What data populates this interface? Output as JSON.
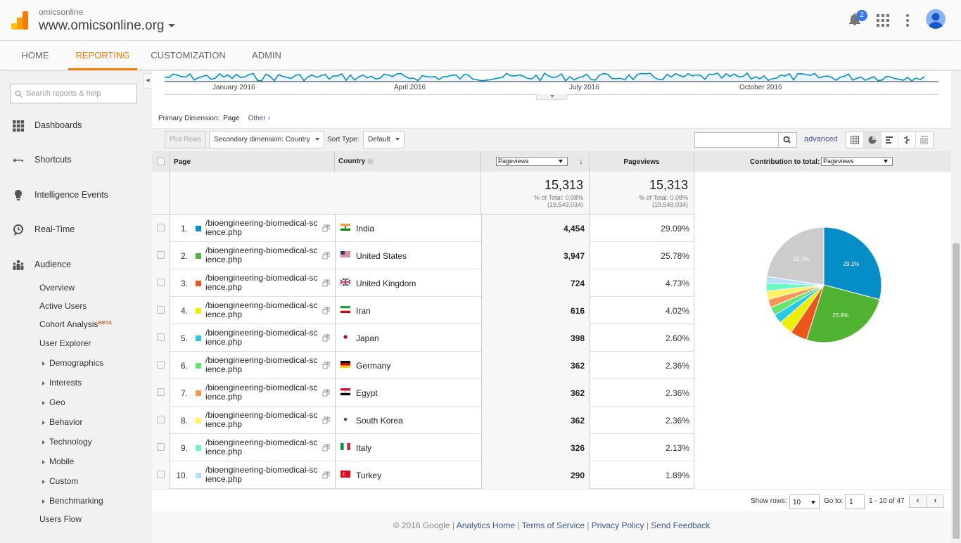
{
  "header": {
    "account": "omicsonline",
    "property": "www.omicsonline.org",
    "notification_count": "2"
  },
  "nav": {
    "tabs": [
      {
        "label": "HOME",
        "active": false
      },
      {
        "label": "REPORTING",
        "active": true
      },
      {
        "label": "CUSTOMIZATION",
        "active": false
      },
      {
        "label": "ADMIN",
        "active": false
      }
    ]
  },
  "sidebar": {
    "search_placeholder": "Search reports & help",
    "items": [
      {
        "label": "Dashboards",
        "icon": "grid-icon"
      },
      {
        "label": "Shortcuts",
        "icon": "shortcut-arrow-icon"
      },
      {
        "label": "Intelligence Events",
        "icon": "lightbulb-icon"
      },
      {
        "label": "Real-Time",
        "icon": "clock-icon"
      },
      {
        "label": "Audience",
        "icon": "people-icon"
      }
    ],
    "audience_sub": [
      {
        "label": "Overview",
        "expandable": false
      },
      {
        "label": "Active Users",
        "expandable": false
      },
      {
        "label": "Cohort Analysis",
        "badge": "BETA",
        "expandable": false
      },
      {
        "label": "User Explorer",
        "expandable": false
      },
      {
        "label": "Demographics",
        "expandable": true
      },
      {
        "label": "Interests",
        "expandable": true
      },
      {
        "label": "Geo",
        "expandable": true
      },
      {
        "label": "Behavior",
        "expandable": true
      },
      {
        "label": "Technology",
        "expandable": true
      },
      {
        "label": "Mobile",
        "expandable": true
      },
      {
        "label": "Custom",
        "expandable": true
      },
      {
        "label": "Benchmarking",
        "expandable": true
      },
      {
        "label": "Users Flow",
        "expandable": false
      }
    ]
  },
  "timeline": {
    "labels": [
      "January 2016",
      "April 2016",
      "July 2016",
      "October 2016"
    ],
    "color": "#058dc7"
  },
  "dimension": {
    "label": "Primary Dimension:",
    "value": "Page",
    "other": "Other"
  },
  "toolbar": {
    "plot_rows": "Plot Rows",
    "secondary_dimension": "Secondary dimension: Country",
    "sort_type_label": "Sort Type:",
    "sort_type_value": "Default",
    "search_value": "",
    "advanced": "advanced"
  },
  "table": {
    "headers": {
      "page": "Page",
      "country": "Country",
      "metric_select": "Pageviews",
      "pageviews": "Pageviews",
      "contribution_label": "Contribution to total:",
      "contribution_select": "Pageviews"
    },
    "totals": {
      "value": "15,313",
      "pct_line": "% of Total: 0.08%",
      "total_line": "(19,549,034)",
      "value2": "15,313",
      "pct_line2": "% of Total: 0.08%",
      "total_line2": "(19,549,034)"
    },
    "rows": [
      {
        "n": "1.",
        "page_l1": "/bioengineering-biomedical-sc",
        "page_l2": "ience.php",
        "country": "India",
        "pageviews": "4,454",
        "pct": "29.09%",
        "color": "#058dc7"
      },
      {
        "n": "2.",
        "page_l1": "/bioengineering-biomedical-sc",
        "page_l2": "ience.php",
        "country": "United States",
        "pageviews": "3,947",
        "pct": "25.78%",
        "color": "#50b432"
      },
      {
        "n": "3.",
        "page_l1": "/bioengineering-biomedical-sc",
        "page_l2": "ience.php",
        "country": "United Kingdom",
        "pageviews": "724",
        "pct": "4.73%",
        "color": "#ed561b"
      },
      {
        "n": "4.",
        "page_l1": "/bioengineering-biomedical-sc",
        "page_l2": "ience.php",
        "country": "Iran",
        "pageviews": "616",
        "pct": "4.02%",
        "color": "#edef00"
      },
      {
        "n": "5.",
        "page_l1": "/bioengineering-biomedical-sc",
        "page_l2": "ience.php",
        "country": "Japan",
        "pageviews": "398",
        "pct": "2.60%",
        "color": "#24cbe5"
      },
      {
        "n": "6.",
        "page_l1": "/bioengineering-biomedical-sc",
        "page_l2": "ience.php",
        "country": "Germany",
        "pageviews": "362",
        "pct": "2.36%",
        "color": "#64e572"
      },
      {
        "n": "7.",
        "page_l1": "/bioengineering-biomedical-sc",
        "page_l2": "ience.php",
        "country": "Egypt",
        "pageviews": "362",
        "pct": "2.36%",
        "color": "#ff9655"
      },
      {
        "n": "8.",
        "page_l1": "/bioengineering-biomedical-sc",
        "page_l2": "ience.php",
        "country": "South Korea",
        "pageviews": "362",
        "pct": "2.36%",
        "color": "#fff263"
      },
      {
        "n": "9.",
        "page_l1": "/bioengineering-biomedical-sc",
        "page_l2": "ience.php",
        "country": "Italy",
        "pageviews": "326",
        "pct": "2.13%",
        "color": "#6af9c4"
      },
      {
        "n": "10.",
        "page_l1": "/bioengineering-biomedical-sc",
        "page_l2": "ience.php",
        "country": "Turkey",
        "pageviews": "290",
        "pct": "1.89%",
        "color": "#b2deff"
      }
    ]
  },
  "chart_data": {
    "type": "pie",
    "title": "Contribution to total: Pageviews",
    "categories": [
      "India",
      "United States",
      "United Kingdom",
      "Iran",
      "Japan",
      "Germany",
      "Egypt",
      "South Korea",
      "Italy",
      "Turkey",
      "Other"
    ],
    "values": [
      29.09,
      25.78,
      4.73,
      4.02,
      2.6,
      2.36,
      2.36,
      2.36,
      2.13,
      1.89,
      22.68
    ],
    "colors": [
      "#058dc7",
      "#50b432",
      "#ed561b",
      "#edef00",
      "#24cbe5",
      "#64e572",
      "#ff9655",
      "#fff263",
      "#6af9c4",
      "#b2deff",
      "#cccccc"
    ],
    "data_labels": [
      "29.1%",
      "25.8%",
      "",
      "",
      "",
      "",
      "",
      "",
      "",
      "",
      "22.7%"
    ]
  },
  "pager": {
    "show_rows_label": "Show rows:",
    "show_rows_value": "10",
    "goto_label": "Go to:",
    "goto_value": "1",
    "range": "1 - 10 of 47"
  },
  "footer": {
    "copyright": "© 2016 Google",
    "links": [
      "Analytics Home",
      "Terms of Service",
      "Privacy Policy",
      "Send Feedback"
    ]
  }
}
